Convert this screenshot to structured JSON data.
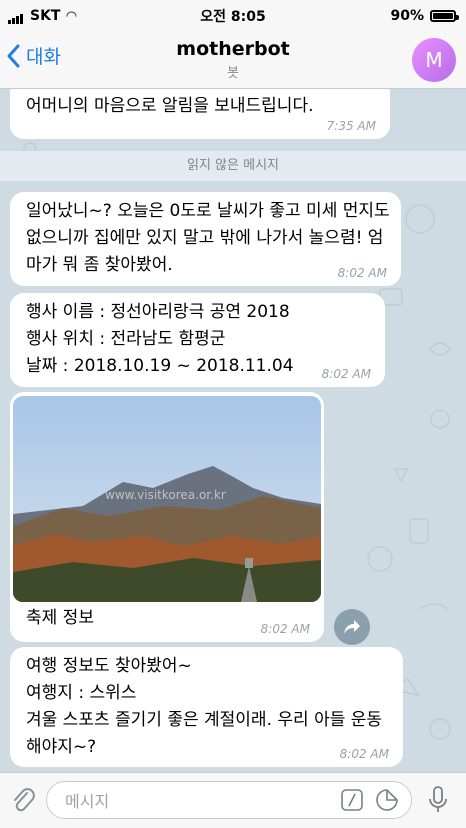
{
  "status_bar": {
    "carrier": "SKT",
    "time": "오전 8:05",
    "battery": "90%",
    "battery_level": 0.9
  },
  "nav": {
    "back_label": "대화",
    "title": "motherbot",
    "subtitle": "봇",
    "avatar_letter": "M"
  },
  "messages": [
    {
      "text": "어머니의 마음으로 알림을 보내드립니다.",
      "time": "7:35 AM"
    },
    {
      "text": "일어났니~? 오늘은 0도로 날씨가 좋고 미세 먼지도 없으니까 집에만 있지 말고 밖에 나가서 놀으렴! 엄마가 뭐 좀 찾아봤어.",
      "time": "8:02 AM"
    },
    {
      "lines": [
        "행사 이름 : 정선아리랑극 공연 2018",
        "행사 위치 : 전라남도 함평군",
        "날짜 : 2018.10.19 ~ 2018.11.04"
      ],
      "time": "8:02 AM"
    },
    {
      "caption": "축제 정보",
      "watermark": "www.visitkorea.or.kr",
      "time": "8:02 AM"
    },
    {
      "lines": [
        "여행 정보도 찾아봤어~",
        "여행지 : 스위스",
        "겨울 스포츠 즐기기 좋은 계절이래. 우리 아들 운동 해야지~?"
      ],
      "time": "8:02 AM"
    }
  ],
  "divider": "읽지 않은 메시지",
  "input": {
    "placeholder": "메시지"
  },
  "colors": {
    "accent": "#1f7fe5",
    "chat_bg": "#cfdbe3",
    "bubble": "#ffffff"
  }
}
